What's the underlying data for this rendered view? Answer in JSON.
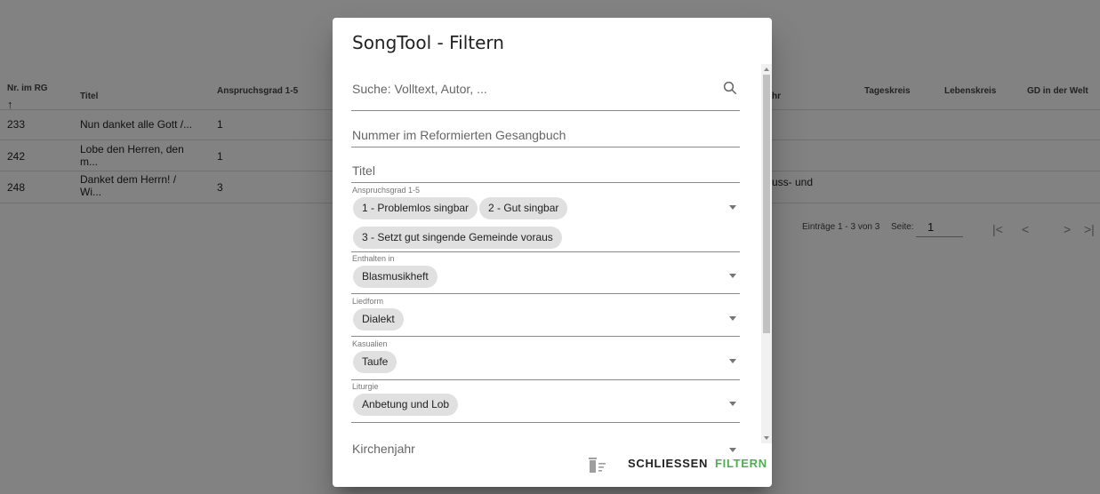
{
  "table": {
    "columns": [
      "Nr. im RG",
      "Titel",
      "Anspruchsgrad 1-5",
      "hr",
      "Tageskreis",
      "Lebenskreis",
      "GD in der Welt"
    ],
    "sort_icon": "arrow-up-icon",
    "rows": [
      {
        "nr": "233",
        "titel": "Nun danket alle Gott /...",
        "grad": "1",
        "partial": ""
      },
      {
        "nr": "242",
        "titel": "Lobe den Herren, den m...",
        "grad": "1",
        "partial": ""
      },
      {
        "nr": "248",
        "titel": "Danket dem Herrn! / Wi...",
        "grad": "3",
        "partial": "uss- und"
      }
    ],
    "pagination": {
      "range": "Einträge 1 - 3 von 3",
      "page_label": "Seite:",
      "page_value": "1",
      "first": "|<",
      "prev": "<",
      "next": ">",
      "last": ">|"
    }
  },
  "dialog": {
    "title": "SongTool - Filtern",
    "search": {
      "placeholder": "Suche: Volltext, Autor, ...",
      "icon": "search-icon"
    },
    "number_field": {
      "placeholder": "Nummer im Reformierten Gesangbuch"
    },
    "title_field": {
      "placeholder": "Titel"
    },
    "anspruch": {
      "label": "Anspruchsgrad 1-5",
      "chips": [
        "1 - Problemlos singbar",
        "2 - Gut singbar",
        "3 - Setzt gut singende Gemeinde voraus"
      ]
    },
    "enthalten": {
      "label": "Enthalten in",
      "chips": [
        "Blasmusikheft"
      ]
    },
    "liedform": {
      "label": "Liedform",
      "chips": [
        "Dialekt"
      ]
    },
    "kasualien": {
      "label": "Kasualien",
      "chips": [
        "Taufe"
      ]
    },
    "liturgie": {
      "label": "Liturgie",
      "chips": [
        "Anbetung und Lob"
      ]
    },
    "kirchenjahr": {
      "placeholder": "Kirchenjahr"
    },
    "actions": {
      "clear_icon": "clear-filter-icon",
      "close_label": "SCHLIESSEN",
      "filter_label": "FILTERN"
    },
    "colors": {
      "accent": "#4caf50",
      "chip": "#e0e0e0",
      "overlay": "rgba(0,0,0,0.49)"
    }
  }
}
